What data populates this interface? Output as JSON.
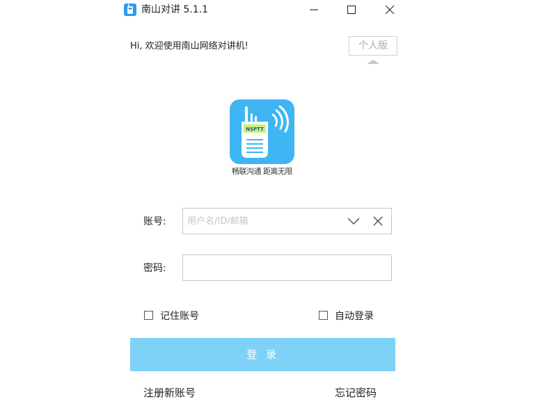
{
  "window": {
    "title": "南山对讲 5.1.1",
    "icon": "walkie-talkie-app-icon",
    "controls": {
      "minimize": "minimize-icon",
      "maximize": "maximize-icon",
      "close": "close-icon"
    }
  },
  "greeting": "Hi, 欢迎使用南山网络对讲机!",
  "edition_button": "个人版",
  "logo": {
    "badge_text": "NSPTT",
    "slogan": "畅联沟通 距离无限",
    "bg_color": "#3fb5f4"
  },
  "form": {
    "account_label": "账号:",
    "account_placeholder": "用户名/ID/邮箱",
    "account_value": "",
    "password_label": "密码:",
    "password_value": "",
    "remember_label": "记住账号",
    "remember_checked": false,
    "auto_login_label": "自动登录",
    "auto_login_checked": false,
    "login_button": "登 录"
  },
  "links": {
    "register": "注册新账号",
    "forgot_password": "忘记密码"
  },
  "colors": {
    "accent": "#7fd2f7",
    "logo_bg": "#3fb5f4",
    "badge": "#c9f27a"
  }
}
